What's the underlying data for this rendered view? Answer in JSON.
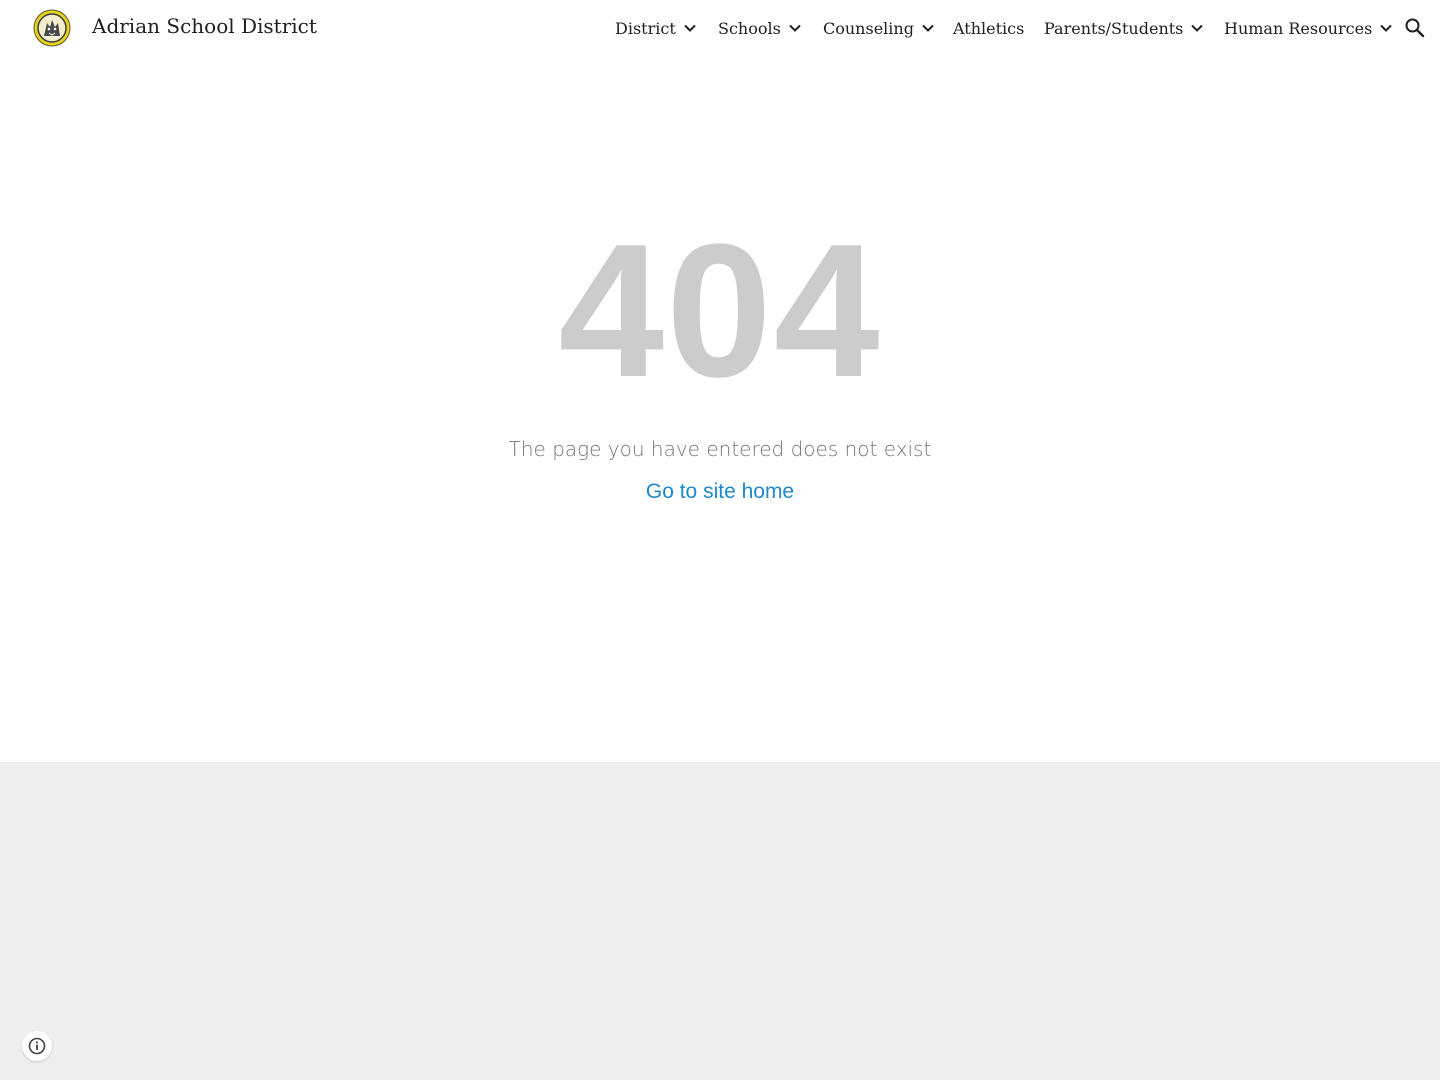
{
  "header": {
    "site_title": "Adrian School District",
    "logo_icon": "school-crest-logo",
    "nav": [
      {
        "label": "District",
        "dropdown": true
      },
      {
        "label": "Schools",
        "dropdown": true
      },
      {
        "label": "Counseling",
        "dropdown": true
      },
      {
        "label": "Athletics",
        "dropdown": false
      },
      {
        "label": "Parents/Students",
        "dropdown": true
      },
      {
        "label": "Human Resources",
        "dropdown": true
      }
    ],
    "search_icon": "search-icon"
  },
  "main": {
    "error_code": "404",
    "message": "The page you have entered does not exist",
    "home_link": "Go to site home"
  },
  "footer": {
    "info_icon": "info-icon"
  },
  "colors": {
    "link": "#1e88c9",
    "error_code": "#cccccc",
    "footer_bg": "#eeeeee"
  }
}
